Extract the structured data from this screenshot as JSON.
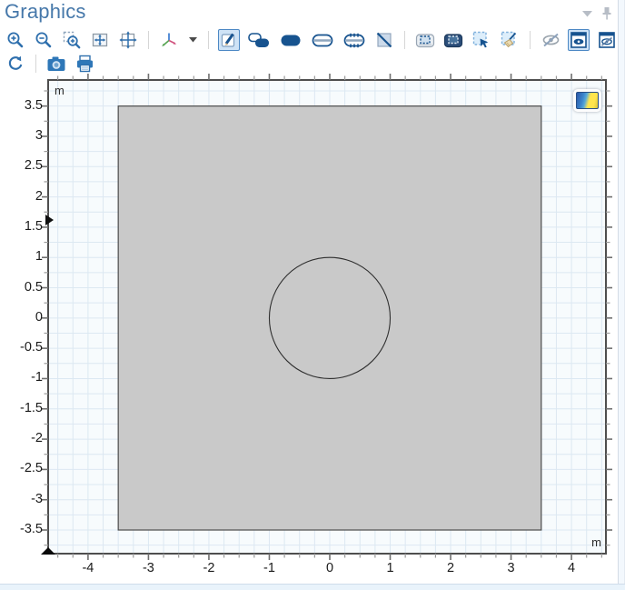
{
  "window": {
    "title": "Graphics"
  },
  "window_controls": [
    {
      "name": "collapse-panel",
      "icon": "chevron-down-icon"
    },
    {
      "name": "pin-panel",
      "icon": "pin-icon"
    }
  ],
  "toolbar": {
    "row1": [
      "zoom-in",
      "zoom-out",
      "zoom-box",
      "zoom-extents",
      "go-to-default-view",
      "view-orientation",
      "view-orientation-dropdown",
      "select",
      "select-objects",
      "select-domains",
      "select-boundaries",
      "select-edges",
      "select-none",
      "show-selection-colors",
      "show-material-color",
      "box-select",
      "clear-selection",
      "hide-objects",
      "view-all",
      "view-unhidden-only",
      "view-hidden-only"
    ],
    "row2": [
      "reset-view",
      "image-snapshot",
      "print"
    ],
    "active_buttons": [
      "select",
      "view-all"
    ],
    "disabled_buttons": [
      "hide-objects"
    ]
  },
  "plot": {
    "unit": "m",
    "x_axis": {
      "min": -4.66,
      "max": 4.57,
      "tick_values": [
        -4,
        -3,
        -2,
        -1,
        0,
        1,
        2,
        3,
        4
      ],
      "tick_labels": [
        "-4",
        "-3",
        "-2",
        "-1",
        "0",
        "1",
        "2",
        "3",
        "4"
      ],
      "minor_step": 0.25
    },
    "y_axis": {
      "min": -3.89,
      "max": 3.93,
      "tick_values": [
        3.5,
        3,
        2.5,
        2,
        1.5,
        1,
        0.5,
        0,
        -0.5,
        -1,
        -1.5,
        -2,
        -2.5,
        -3,
        -3.5
      ],
      "tick_labels": [
        "3.5",
        "3",
        "2.5",
        "2",
        "1.5",
        "1",
        "0.5",
        "0",
        "-0.5",
        "-1",
        "-1.5",
        "-2",
        "-2.5",
        "-3",
        "-3.5"
      ],
      "minor_step": 0.25
    },
    "grid_step": 0.25,
    "shapes": {
      "square": {
        "center": [
          0,
          0
        ],
        "width": 7,
        "height": 7,
        "fill": "#c9c9c9",
        "stroke": "#4d4d4d"
      },
      "circle": {
        "center": [
          0,
          0
        ],
        "radius": 1,
        "fill": "none",
        "stroke": "#2f2f2f"
      }
    },
    "colors": {
      "plot_bg": "#f7fbfd",
      "grid": "#dce8f2",
      "frame": "#4e4e4e",
      "tick_major": "#6f6f6f",
      "tick_minor": "#9a9a9a",
      "label": "#1b1b1b"
    }
  },
  "accent_colors": {
    "title_blue": "#4678aa",
    "icon_blue": "#2e6fad",
    "icon_navy": "#17538f",
    "pressed_bg": "#cfe3f6",
    "pressed_border": "#4c88c4",
    "disabled_gray": "#9aa4ad"
  }
}
